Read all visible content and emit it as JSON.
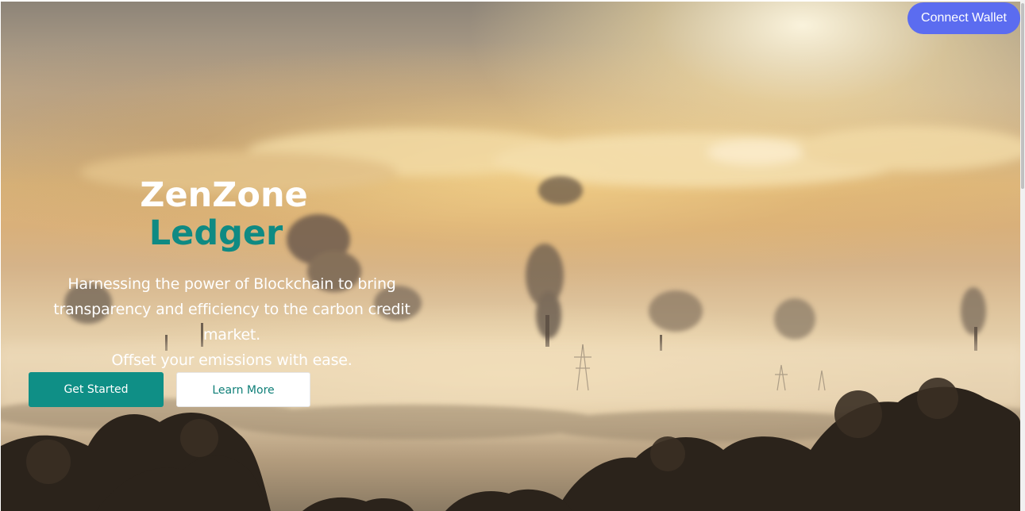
{
  "header": {
    "connect_wallet_label": "Connect Wallet"
  },
  "hero": {
    "title_line1": "ZenZone",
    "title_line2": "Ledger",
    "tagline_line1": "Harnessing the power of Blockchain to bring",
    "tagline_line2": "transparency and efficiency to the carbon credit market.",
    "tagline_line3": "Offset your emissions with ease.",
    "primary_button_label": "Get Started",
    "secondary_button_label": "Learn More"
  },
  "colors": {
    "brand_accent": "#0f8a83",
    "primary_button": "#0f8f86",
    "connect_wallet": "#5b6cf0",
    "title_primary": "#ffffff"
  },
  "icons": {
    "background_image": "industrial-smokestacks-sunset-image"
  }
}
